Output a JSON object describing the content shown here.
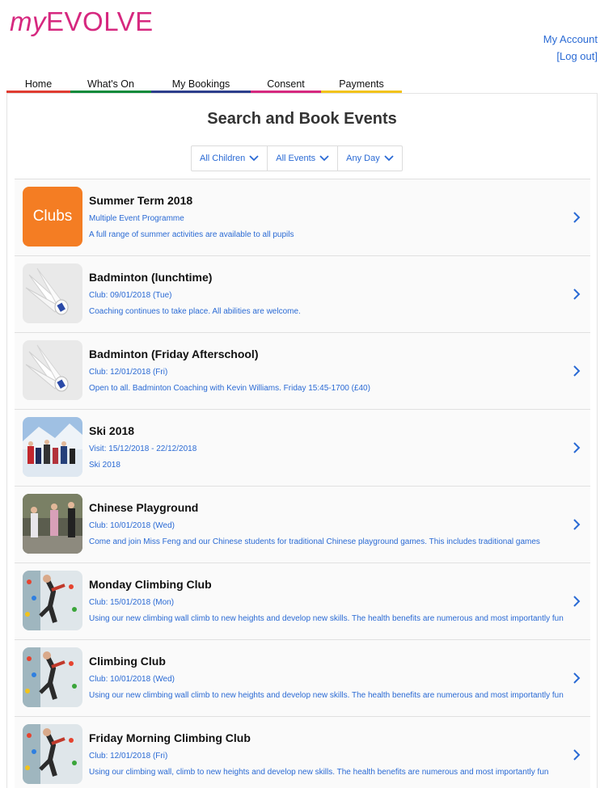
{
  "logo": {
    "prefix": "my",
    "suffix": "EVOLVE"
  },
  "account": {
    "my_account": "My Account",
    "logout": "[Log out]"
  },
  "nav": [
    {
      "label": "Home",
      "color": "#e03c31"
    },
    {
      "label": "What's On",
      "color": "#0a8a3a"
    },
    {
      "label": "My Bookings",
      "color": "#2c3e8c"
    },
    {
      "label": "Consent",
      "color": "#d6287f"
    },
    {
      "label": "Payments",
      "color": "#f2c31b"
    }
  ],
  "page_title": "Search and Book Events",
  "filters": [
    {
      "label": "All Children",
      "icon": "chevron-down-icon"
    },
    {
      "label": "All Events",
      "icon": "chevron-down-icon"
    },
    {
      "label": "Any Day",
      "icon": "chevron-down-icon"
    }
  ],
  "events": [
    {
      "title": "Summer Term 2018",
      "subtitle": "Multiple Event Programme",
      "description": "A full range of summer activities are available to all pupils",
      "thumb_label": "Clubs",
      "thumb": "clubs"
    },
    {
      "title": "Badminton (lunchtime)",
      "subtitle": "Club: 09/01/2018 (Tue)",
      "description": "Coaching continues to take place. All abilities are welcome.",
      "thumb": "shuttlecock"
    },
    {
      "title": "Badminton (Friday Afterschool)",
      "subtitle": "Club: 12/01/2018 (Fri)",
      "description": "Open to all. Badminton Coaching with Kevin Williams. Friday 15:45-1700 (£40)",
      "thumb": "shuttlecock"
    },
    {
      "title": "Ski 2018",
      "subtitle": "Visit: 15/12/2018 - 22/12/2018",
      "description": "Ski 2018",
      "thumb": "ski"
    },
    {
      "title": "Chinese Playground",
      "subtitle": "Club: 10/01/2018 (Wed)",
      "description": "Come and join Miss Feng and our Chinese students for traditional Chinese playground games. This includes traditional games",
      "thumb": "playground"
    },
    {
      "title": "Monday Climbing Club",
      "subtitle": "Club: 15/01/2018 (Mon)",
      "description": "Using our new climbing wall climb to new heights and develop new skills. The health benefits are numerous and most importantly fun",
      "thumb": "climbing"
    },
    {
      "title": "Climbing Club",
      "subtitle": "Club: 10/01/2018 (Wed)",
      "description": "Using our new climbing wall climb to new heights and develop new skills. The health benefits are numerous and most importantly fun",
      "thumb": "climbing"
    },
    {
      "title": "Friday Morning Climbing Club",
      "subtitle": "Club: 12/01/2018 (Fri)",
      "description": "Using our climbing wall, climb to new heights and develop new skills. The health benefits are numerous and most importantly fun",
      "thumb": "climbing"
    }
  ]
}
